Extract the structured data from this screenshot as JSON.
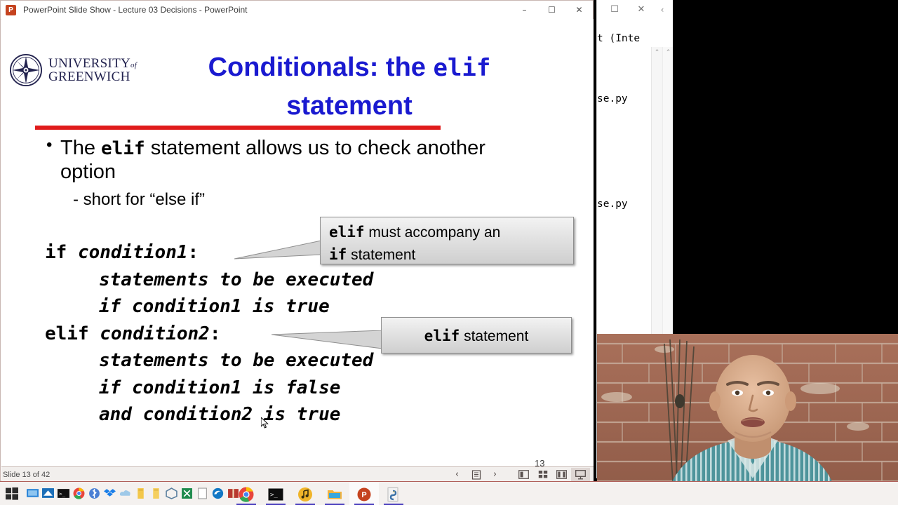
{
  "window": {
    "app_icon": "powerpoint-icon",
    "title": "PowerPoint Slide Show  -  Lecture 03 Decisions - PowerPoint",
    "minimize": "–",
    "maximize": "☐",
    "close": "✕"
  },
  "slide": {
    "logo": {
      "line1": "UNIVERSITY",
      "of": "of",
      "line2": "GREENWICH"
    },
    "title_part1": "Conditionals: the ",
    "title_code": "elif",
    "title_part2": "statement",
    "bullet_main_a": "The ",
    "bullet_main_code": "elif",
    "bullet_main_b": " statement allows us to check another option",
    "bullet_sub": "- short for “else if”",
    "code_lines": [
      {
        "indent": false,
        "prefix": "if ",
        "italic": "condition1",
        "suffix": ":"
      },
      {
        "indent": true,
        "prefix": "",
        "italic": "statements to be executed",
        "suffix": ""
      },
      {
        "indent": true,
        "prefix": "",
        "italic": "if condition1 is true",
        "suffix": ""
      },
      {
        "indent": false,
        "prefix": "elif ",
        "italic": "condition2",
        "suffix": ":"
      },
      {
        "indent": true,
        "prefix": "",
        "italic": "statements to be executed",
        "suffix": ""
      },
      {
        "indent": true,
        "prefix": "",
        "italic": "if condition1 is false",
        "suffix": ""
      },
      {
        "indent": true,
        "prefix": "",
        "italic": "and condition2 is true",
        "suffix": ""
      }
    ],
    "callout1": {
      "code1": "elif",
      "text1": " must accompany an",
      "code2": "if",
      "text2": " statement"
    },
    "callout2": {
      "code": "elif",
      "text": " statement"
    },
    "slide_number": "13",
    "colors": {
      "title_blue": "#1a1ad0",
      "rule_red": "#e01b1b",
      "logo_navy": "#23234f"
    }
  },
  "statusbar": {
    "slide_count": "Slide 13 of 42",
    "prev": "‹",
    "notes": "☰",
    "next": "›",
    "view_normal": "normal-view-icon",
    "view_sorter": "slide-sorter-icon",
    "view_reading": "reading-view-icon",
    "view_slideshow": "slideshow-view-icon"
  },
  "idle_window": {
    "maximize": "☐",
    "close": "✕",
    "chevron": "‹",
    "line1": "t (Inte",
    "line2": "se.py",
    "line3": "se.py",
    "scroll_up": "⌃"
  },
  "taskbar": {
    "start": "start-button",
    "tray": [
      "display-icon",
      "network-icon",
      "terminal-icon",
      "chrome-icon",
      "bluetooth-icon",
      "dropbox-icon",
      "cloud-icon",
      "notes-icon",
      "notes2-icon",
      "box-icon",
      "excel-icon",
      "document-icon",
      "edge-icon",
      "book-icon"
    ],
    "apps": [
      {
        "name": "chrome",
        "label": "Google Chrome",
        "active": false
      },
      {
        "name": "terminal",
        "label": "Terminal",
        "active": false
      },
      {
        "name": "media",
        "label": "Media Player",
        "active": false
      },
      {
        "name": "explorer",
        "label": "File Explorer",
        "active": false
      },
      {
        "name": "powerpoint",
        "label": "PowerPoint",
        "active": true
      },
      {
        "name": "python",
        "label": "Python IDLE",
        "active": false
      }
    ]
  },
  "webcam": {
    "label": "presenter-webcam-feed"
  }
}
